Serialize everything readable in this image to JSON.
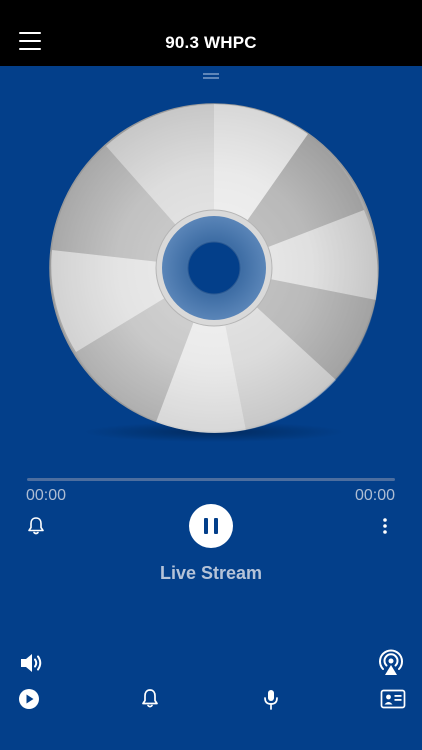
{
  "header": {
    "title": "90.3 WHPC",
    "menu_icon": "hamburger-menu-icon"
  },
  "player": {
    "artwork": "cd-disc-artwork",
    "elapsed": "00:00",
    "duration": "00:00",
    "progress": 0,
    "state": "playing",
    "stream_label": "Live Stream"
  },
  "controls": {
    "alarm_icon": "bell-icon",
    "play_pause_icon": "pause-icon",
    "more_icon": "vertical-dots-icon"
  },
  "bottom_bar": {
    "volume_icon": "speaker-icon",
    "airplay_icon": "airplay-icon",
    "items": [
      {
        "icon": "play-circle-icon"
      },
      {
        "icon": "bell-icon"
      },
      {
        "icon": "microphone-icon"
      },
      {
        "icon": "contact-card-icon"
      }
    ]
  },
  "colors": {
    "background": "#033f8a",
    "header": "#000000",
    "accent": "#ffffff",
    "muted_text": "#aebdd3",
    "disc_hub": "#4a77ac"
  }
}
